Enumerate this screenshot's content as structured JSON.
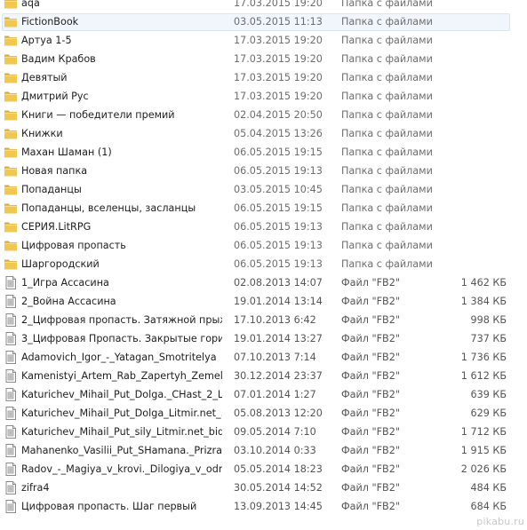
{
  "entries": [
    {
      "name": "aqa",
      "date": "17.03.2015 19:20",
      "type": "Папка с файлами",
      "size": "",
      "icon": "folder-icon"
    },
    {
      "name": "FictionBook",
      "date": "03.05.2015 11:13",
      "type": "Папка с файлами",
      "size": "",
      "icon": "folder-icon",
      "selected": true
    },
    {
      "name": "Артуа 1-5",
      "date": "17.03.2015 19:20",
      "type": "Папка с файлами",
      "size": "",
      "icon": "folder-icon"
    },
    {
      "name": "Вадим Крабов",
      "date": "17.03.2015 19:20",
      "type": "Папка с файлами",
      "size": "",
      "icon": "folder-icon"
    },
    {
      "name": "Девятый",
      "date": "17.03.2015 19:20",
      "type": "Папка с файлами",
      "size": "",
      "icon": "folder-icon"
    },
    {
      "name": "Дмитрий Рус",
      "date": "17.03.2015 19:20",
      "type": "Папка с файлами",
      "size": "",
      "icon": "folder-icon"
    },
    {
      "name": "Книги — победители премий",
      "date": "02.04.2015 20:50",
      "type": "Папка с файлами",
      "size": "",
      "icon": "folder-icon"
    },
    {
      "name": "Книжки",
      "date": "05.04.2015 13:26",
      "type": "Папка с файлами",
      "size": "",
      "icon": "folder-icon"
    },
    {
      "name": "Махан Шаман (1)",
      "date": "06.05.2015 19:15",
      "type": "Папка с файлами",
      "size": "",
      "icon": "folder-icon"
    },
    {
      "name": "Новая папка",
      "date": "06.05.2015 19:13",
      "type": "Папка с файлами",
      "size": "",
      "icon": "folder-icon"
    },
    {
      "name": "Попаданцы",
      "date": "03.05.2015 10:45",
      "type": "Папка с файлами",
      "size": "",
      "icon": "folder-icon"
    },
    {
      "name": "Попаданцы, вселенцы, засланцы",
      "date": "06.05.2015 19:15",
      "type": "Папка с файлами",
      "size": "",
      "icon": "folder-icon"
    },
    {
      "name": "СЕРИЯ.LitRPG",
      "date": "06.05.2015 19:13",
      "type": "Папка с файлами",
      "size": "",
      "icon": "folder-icon"
    },
    {
      "name": "Цифровая пропасть",
      "date": "06.05.2015 19:13",
      "type": "Папка с файлами",
      "size": "",
      "icon": "folder-icon"
    },
    {
      "name": "Шаргородский",
      "date": "06.05.2015 19:13",
      "type": "Папка с файлами",
      "size": "",
      "icon": "folder-icon"
    },
    {
      "name": "1_Игра Ассасина",
      "date": "02.08.2013 14:07",
      "type": "Файл \"FB2\"",
      "size": "1 462 КБ",
      "icon": "file-icon"
    },
    {
      "name": "2_Война Ассасина",
      "date": "19.01.2014 13:14",
      "type": "Файл \"FB2\"",
      "size": "1 384 КБ",
      "icon": "file-icon"
    },
    {
      "name": "2_Цифровая пропасть. Затяжной прыж...",
      "date": "17.10.2013 6:42",
      "type": "Файл \"FB2\"",
      "size": "998 КБ",
      "icon": "file-icon"
    },
    {
      "name": "3_Цифровая Пропасть. Закрытые гори...",
      "date": "19.01.2014 13:27",
      "type": "Файл \"FB2\"",
      "size": "737 КБ",
      "icon": "file-icon"
    },
    {
      "name": "Adamovich_Igor_-_Yatagan_Smotritelya",
      "date": "07.10.2013 7:14",
      "type": "Файл \"FB2\"",
      "size": "1 736 КБ",
      "icon": "file-icon"
    },
    {
      "name": "Kamenistyi_Artem_Rab_Zapertyh_Zemel_...",
      "date": "30.12.2014 23:37",
      "type": "Файл \"FB2\"",
      "size": "1 612 КБ",
      "icon": "file-icon"
    },
    {
      "name": "Katurichev_Mihail_Put_Dolga._CHast_2_L...",
      "date": "07.01.2014 1:27",
      "type": "Файл \"FB2\"",
      "size": "639 КБ",
      "icon": "file-icon"
    },
    {
      "name": "Katurichev_Mihail_Put_Dolga_Litmir.net_...",
      "date": "05.08.2013 12:20",
      "type": "Файл \"FB2\"",
      "size": "629 КБ",
      "icon": "file-icon"
    },
    {
      "name": "Katurichev_Mihail_Put_sily_Litmir.net_bid...",
      "date": "09.05.2014 7:10",
      "type": "Файл \"FB2\"",
      "size": "1 712 КБ",
      "icon": "file-icon"
    },
    {
      "name": "Mahanenko_Vasilii_Put_SHamana._Prizra...",
      "date": "03.10.2014 0:33",
      "type": "Файл \"FB2\"",
      "size": "1 915 КБ",
      "icon": "file-icon"
    },
    {
      "name": "Radov_-_Magiya_v_krovi._Dilogiya_v_odn...",
      "date": "05.05.2014 18:23",
      "type": "Файл \"FB2\"",
      "size": "2 026 КБ",
      "icon": "file-icon"
    },
    {
      "name": "zifra4",
      "date": "30.05.2014 14:52",
      "type": "Файл \"FB2\"",
      "size": "484 КБ",
      "icon": "file-icon"
    },
    {
      "name": "Цифровая пропасть. Шаг первый",
      "date": "13.09.2013 14:45",
      "type": "Файл \"FB2\"",
      "size": "684 КБ",
      "icon": "file-icon"
    }
  ],
  "watermark": "pikabu.ru",
  "colors": {
    "folder_body": "#f0c850",
    "folder_tab": "#d9a93a",
    "selection_bg": "#f1f6fc",
    "selection_border": "#d9e5f3",
    "secondary_text": "#6d6d6d"
  }
}
